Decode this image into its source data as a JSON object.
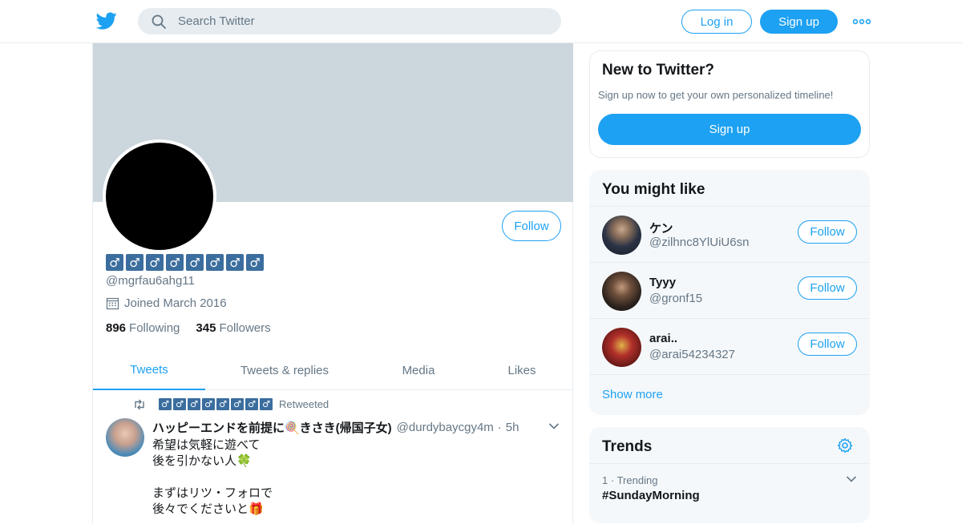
{
  "nav": {
    "search_placeholder": "Search Twitter",
    "login_label": "Log in",
    "signup_label": "Sign up"
  },
  "profile": {
    "display_name_glyph": "♂",
    "display_name_count": 8,
    "handle": "@mgrfau6ahg11",
    "joined": "Joined March 2016",
    "following_count": "896",
    "following_label": "Following",
    "followers_count": "345",
    "followers_label": "Followers",
    "follow_label": "Follow"
  },
  "tabs": [
    {
      "label": "Tweets",
      "active": true
    },
    {
      "label": "Tweets & replies",
      "active": false
    },
    {
      "label": "Media",
      "active": false
    },
    {
      "label": "Likes",
      "active": false
    }
  ],
  "tweet": {
    "retweeted_label": "Retweeted",
    "author_name": "ハッピーエンドを前提に🍭きさき(帰国子女)",
    "author_handle": "@durdybaycgy4m",
    "separator": "·",
    "time": "5h",
    "text": "希望は気軽に遊べて\n後を引かない人🍀\n\nまずはリツ・フォロで\n後々でくださいと🎁"
  },
  "sidebar": {
    "new_title": "New to Twitter?",
    "new_subtitle": "Sign up now to get your own personalized timeline!",
    "new_button": "Sign up",
    "like_title": "You might like",
    "suggestions": [
      {
        "name": "ケン",
        "handle": "@zilhnc8YlUiU6sn",
        "follow": "Follow"
      },
      {
        "name": "Tyyy",
        "handle": "@gronf15",
        "follow": "Follow"
      },
      {
        "name": "arai..",
        "handle": "@arai54234327",
        "follow": "Follow"
      }
    ],
    "show_more": "Show more",
    "trends_title": "Trends",
    "trend": {
      "rank": "1",
      "separator": "·",
      "meta": "Trending",
      "name": "#SundayMorning"
    }
  },
  "colors": {
    "accent": "#1da1f2",
    "banner": "#ccd6dd",
    "panel": "#f5f8fa",
    "muted": "#657786"
  },
  "icons": [
    "twitter-bird-icon",
    "search-icon",
    "more-dots-icon",
    "calendar-icon",
    "retweet-icon",
    "chevron-down-icon",
    "gear-icon"
  ]
}
